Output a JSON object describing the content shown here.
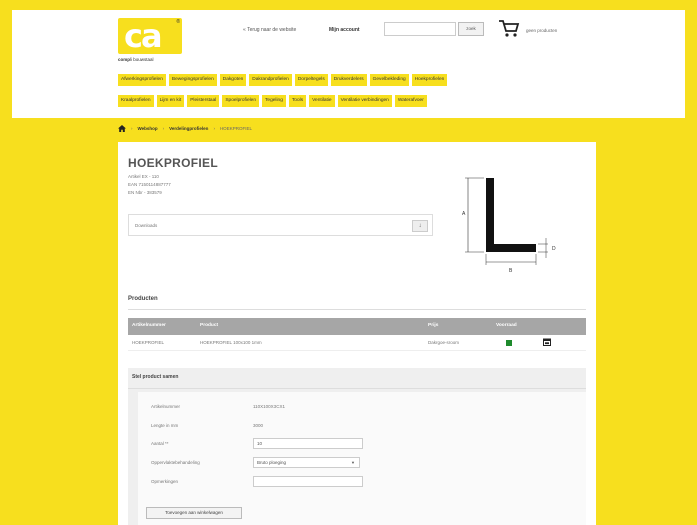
{
  "brand": {
    "logo_text": "ca",
    "tagline_bold": "comp",
    "tagline_rest": "li bouwstaal"
  },
  "header": {
    "back_link": "« Terug naar de website",
    "account": "Mijn account",
    "search_placeholder": "",
    "search_button": "zoek",
    "cart_text": "geen producten"
  },
  "nav": {
    "row1": [
      "Afwerkingsprofielen",
      "Bewegingsprofielen",
      "Dakgoten",
      "Dakrandprofielen",
      "Dorpeltegels",
      "Drukverdelers",
      "Gevelbekleding",
      "Hoekprofielen"
    ],
    "row2": [
      "Kraalprofielen",
      "Lijm en kit",
      "Pleisterstaal",
      "Spoelprofielen",
      "Tegeling",
      "Tools",
      "Ventilatie",
      "Ventilatie verbindingen",
      "Waterafvoer"
    ]
  },
  "breadcrumb": {
    "items": [
      "Webshop",
      "Verdelingprofielen",
      "HOEKPROFIEL"
    ]
  },
  "product": {
    "title": "HOEKPROFIEL",
    "meta": [
      "Artikel EX - 110",
      "EAN 7150114887777",
      "EN Nbr - 383579"
    ],
    "download_label": "Downloads",
    "download_icon": "download-icon",
    "dims": {
      "a": "A",
      "b": "B",
      "d": "D"
    }
  },
  "products_section": {
    "title": "Producten",
    "columns": [
      "Artikelnummer",
      "Product",
      "Prijs",
      "Voorraad"
    ],
    "rows": [
      {
        "article": "HOEKPROFIEL",
        "product": "HOEKPROFIEL 100x100 1mm",
        "price": "Dakrgoe-sroom",
        "stock": "op voorraad"
      }
    ]
  },
  "order_form": {
    "title": "Stel product samen",
    "fields": [
      {
        "label": "Artikelnummer",
        "value": "110X100X3CX1"
      },
      {
        "label": "Lengte in mm",
        "value": "3000"
      },
      {
        "label": "Aantal **",
        "input": "10"
      },
      {
        "label": "Oppervlaktebehandeling",
        "select": "Bruto ploeging"
      },
      {
        "label": "Opmerkingen",
        "input": ""
      }
    ],
    "submit": "Toevoegen aan winkelwagen"
  },
  "colors": {
    "brand_yellow": "#f7df1e",
    "table_header": "#a6a6a6",
    "stock_green": "#1e8a2c"
  }
}
